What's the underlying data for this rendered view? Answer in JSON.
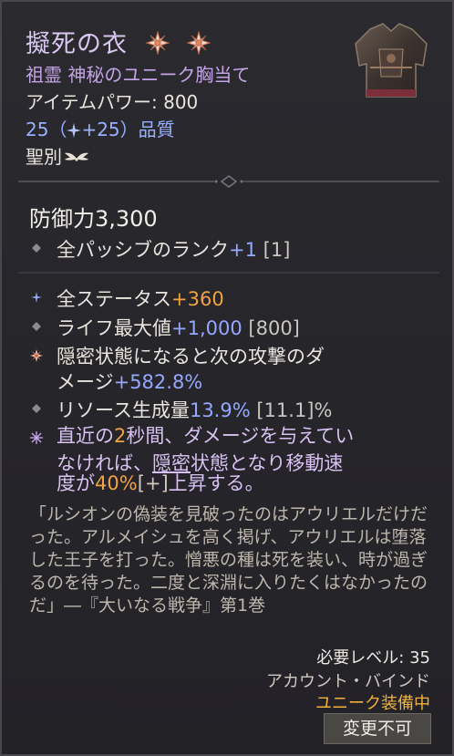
{
  "item": {
    "name": "擬死の衣",
    "subtitle": "祖霊 神秘のユニーク胸当て",
    "item_power_label": "アイテムパワー: 800",
    "quality_prefix": "25（",
    "quality_bonus": "+25",
    "quality_suffix": "）品質",
    "sacred_label": "聖別",
    "image_icon": "chest-armor-icon"
  },
  "defense": {
    "label": "防御力3,300"
  },
  "implicit": {
    "text": "全パッシブのランク",
    "value": "+1",
    "bracket": "[1]"
  },
  "affixes": [
    {
      "text": "全ステータス",
      "value": "+360",
      "bracket": ""
    },
    {
      "text": "ライフ最大値",
      "value": "+1,000",
      "bracket": "[800]"
    },
    {
      "line1": "隠密状態になると次の攻撃のダ",
      "line2_prefix": "メージ",
      "value": "+582.8%"
    },
    {
      "text": "リソース生成量",
      "value": "13.9%",
      "bracket": "[11.1]%"
    }
  ],
  "unique_power": {
    "line1_a": "直近の",
    "line1_num": "2",
    "line1_b": "秒間、ダメージを与えてい",
    "line2_a": "なければ、",
    "line2_keyword": "隠密",
    "line2_b": "状態となり移動速",
    "line3_a": "度が",
    "line3_num": "40%",
    "line3_plus": "[+]",
    "line3_b": "上昇する。"
  },
  "flavor_text": "「ルシオンの偽装を見破ったのはアウリエルだけだった。アルメイシュを高く掲げ、アウリエルは堕落した王子を打った。憎悪の種は死を装い、時が過ぎるのを待った。二度と深淵に入りたくはなかったのだ」―『大いなる戦争』第1巻",
  "footer": {
    "required_level": "必要レベル: 35",
    "account_bound": "アカウント・バインド",
    "unique_equipped": "ユニーク装備中",
    "unchangeable_button": "変更不可"
  },
  "colors": {
    "title": "#d8c8f0",
    "subtitle": "#c4a3e6",
    "orange_value": "#f2a341",
    "blue_value": "#95a8ff",
    "unique_equipped": "#f0b23a"
  }
}
